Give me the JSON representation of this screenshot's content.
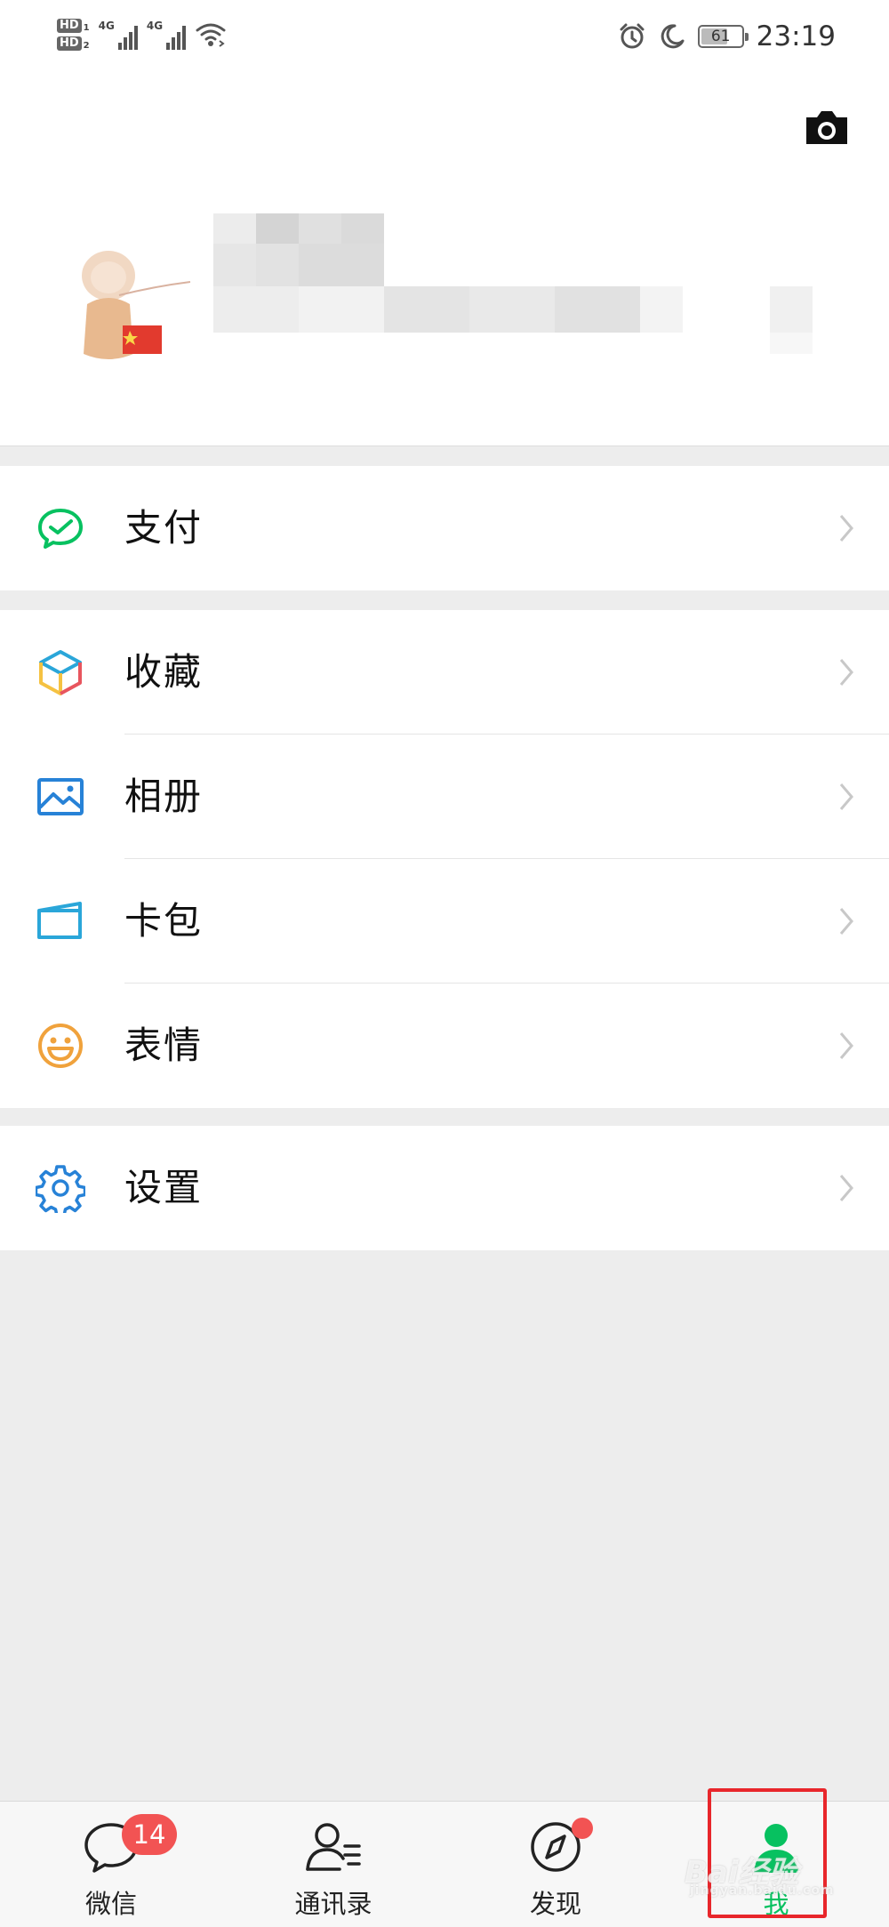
{
  "status_bar": {
    "hd1": "HD",
    "hd1_sub": "1",
    "hd2": "HD",
    "hd2_sub": "2",
    "net1": "4G",
    "net2": "4G",
    "battery_level": "61",
    "time": "23:19",
    "icons": [
      "signal-icon",
      "wifi-icon",
      "alarm-icon",
      "moon-icon",
      "battery-icon"
    ]
  },
  "profile": {
    "icons": [
      "camera-icon",
      "avatar"
    ]
  },
  "menu": {
    "section1": [
      {
        "label": "支付",
        "icon": "wechat-pay-icon",
        "color": "#07c160"
      }
    ],
    "section2": [
      {
        "label": "收藏",
        "icon": "favorites-cube-icon"
      },
      {
        "label": "相册",
        "icon": "album-icon",
        "color": "#2782d7"
      },
      {
        "label": "卡包",
        "icon": "card-wallet-icon",
        "color": "#2aa6d9"
      },
      {
        "label": "表情",
        "icon": "sticker-smiley-icon",
        "color": "#f0a23c"
      }
    ],
    "section3": [
      {
        "label": "设置",
        "icon": "settings-gear-icon",
        "color": "#2782d7"
      }
    ]
  },
  "tabbar": {
    "tabs": [
      {
        "label": "微信",
        "icon": "chat-bubble-icon",
        "badge": "14"
      },
      {
        "label": "通讯录",
        "icon": "contacts-icon"
      },
      {
        "label": "发现",
        "icon": "discover-compass-icon"
      },
      {
        "label": "我",
        "icon": "me-person-icon",
        "active": true
      }
    ],
    "active_color": "#07c160",
    "badge_color": "#f25353"
  },
  "watermark": {
    "text": "Bai经验",
    "sub": "jingyan.baidu.com"
  }
}
